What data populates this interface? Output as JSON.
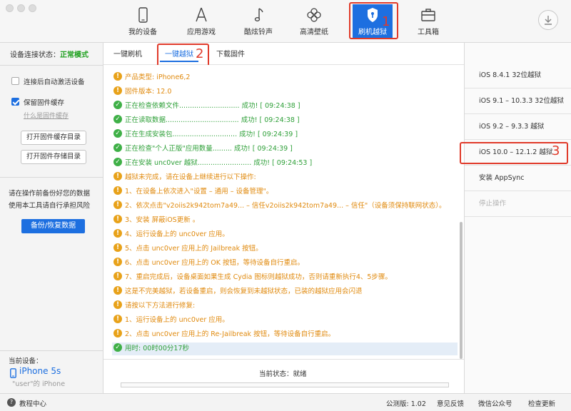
{
  "toolbar": {
    "items": [
      {
        "label": "我的设备",
        "icon": "phone-icon"
      },
      {
        "label": "应用游戏",
        "icon": "app-store-icon"
      },
      {
        "label": "酷炫铃声",
        "icon": "music-note-icon"
      },
      {
        "label": "高清壁纸",
        "icon": "flower-icon"
      },
      {
        "label": "刷机越狱",
        "icon": "shield-key-icon",
        "active": true
      },
      {
        "label": "工具箱",
        "icon": "toolbox-icon"
      }
    ],
    "download_icon": "download-icon",
    "accent": "#1d6fe0"
  },
  "annotations": {
    "n1": "1",
    "n2": "2",
    "n3": "3",
    "color": "#e03a2a"
  },
  "left": {
    "status_label": "设备连接状态：",
    "status_value": "正常模式",
    "auto_activate": "连接后自动激活设备",
    "keep_cache": "保留固件缓存",
    "what_cache": "什么是固件缓存",
    "open_cache_dir": "打开固件缓存目录",
    "open_store_dir": "打开固件存储目录",
    "note1": "请在操作前备份好您的数据",
    "note2": "使用本工具请自行承担风险",
    "backup_btn": "备份/恢复数据",
    "current_device_label": "当前设备：",
    "device_name": "iPhone 5s",
    "device_sub": "\"user\"的 iPhone"
  },
  "tabs": [
    "一键刷机",
    "一键越狱",
    "下载固件"
  ],
  "log": [
    {
      "type": "warn",
      "text": "产品类型: iPhone6,2"
    },
    {
      "type": "warn",
      "text": "固件版本: 12.0"
    },
    {
      "type": "ok",
      "text": "正在检查依赖文件............................ 成功! [ 09:24:38 ]"
    },
    {
      "type": "ok",
      "text": "正在读取数据.................................. 成功! [ 09:24:38 ]"
    },
    {
      "type": "ok",
      "text": "正在生成安装包.............................. 成功! [ 09:24:39 ]"
    },
    {
      "type": "ok",
      "text": "正在检查\"个人正版\"应用数量......... 成功! [ 09:24:39 ]"
    },
    {
      "type": "ok",
      "text": "正在安装 unc0ver 越狱......................... 成功! [ 09:24:53 ]"
    },
    {
      "type": "warn",
      "text": "越狱未完成，请在设备上继续进行以下操作:"
    },
    {
      "type": "warn",
      "text": "1、在设备上依次进入\"设置 – 通用 – 设备管理\"。"
    },
    {
      "type": "warn",
      "text": "2、依次点击\"v2oiis2k942tom7a49... – 信任v2oiis2k942tom7a49... – 信任\"（设备须保持联网状态）。"
    },
    {
      "type": "warn",
      "text": "3、安装 屏蔽iOS更新 。"
    },
    {
      "type": "warn",
      "text": "4、运行设备上的 unc0ver 应用。"
    },
    {
      "type": "warn",
      "text": "5、点击 unc0ver 应用上的 Jailbreak 按钮。"
    },
    {
      "type": "warn",
      "text": "6、点击 unc0ver 应用上的 OK 按钮，等待设备自行重启。"
    },
    {
      "type": "warn",
      "text": "7、重启完成后，设备桌面如果生成 Cydia 图标则越狱成功，否则请重新执行4、5步骤。"
    },
    {
      "type": "warn",
      "text": "这是不完美越狱，若设备重启，则会恢复到未越狱状态，已装的越狱应用会闪退"
    },
    {
      "type": "warn",
      "text": "请按以下方法进行修复:"
    },
    {
      "type": "warn",
      "text": "1、运行设备上的 unc0ver 应用。"
    },
    {
      "type": "warn",
      "text": "2、点击 unc0ver 应用上的 Re-Jailbreak 按钮，等待设备自行重启。"
    },
    {
      "type": "ok",
      "text": "用时: 00时00分17秒",
      "highlight": true
    }
  ],
  "status_text": "当前状态：就绪",
  "right_items": [
    {
      "label": "iOS 8.4.1 32位越狱"
    },
    {
      "label": "iOS 9.1 – 10.3.3 32位越狱"
    },
    {
      "label": "iOS 9.2 – 9.3.3 越狱"
    },
    {
      "label": "iOS 10.0 – 12.1.2 越狱"
    },
    {
      "label": "安装 AppSync"
    },
    {
      "label": "停止操作",
      "disabled": true
    }
  ],
  "footer": {
    "help": "教程中心",
    "version": "公测版: 1.02",
    "feedback": "意见反馈",
    "wechat": "微信公众号",
    "update": "检查更新"
  }
}
